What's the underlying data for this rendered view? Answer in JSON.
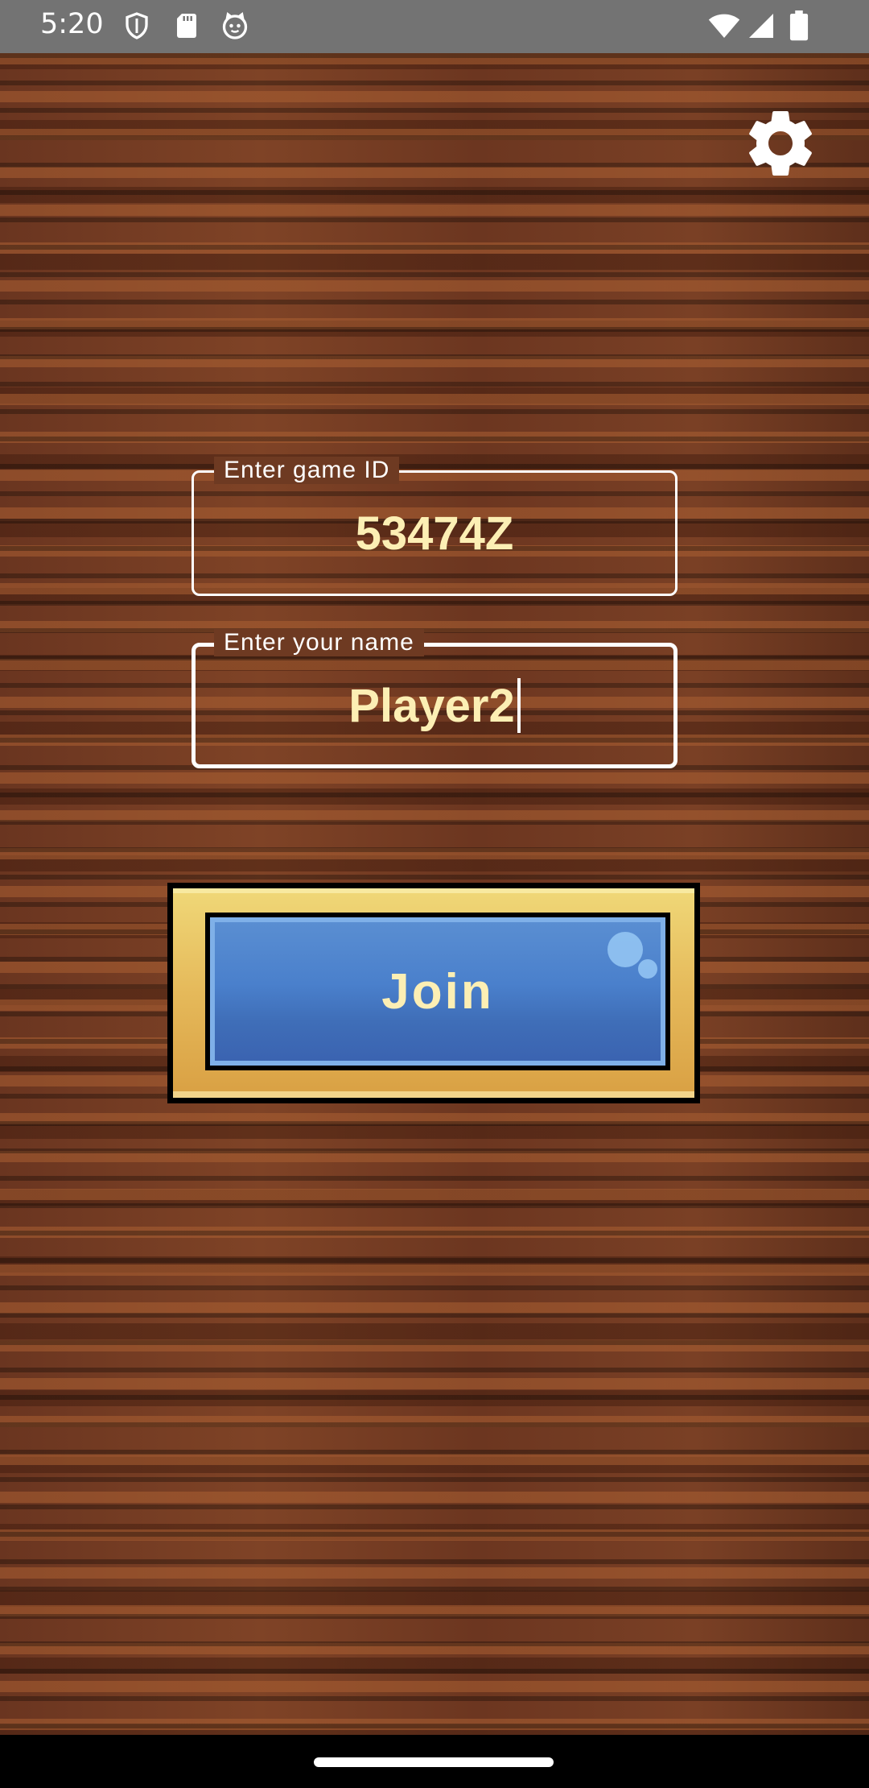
{
  "status_bar": {
    "time": "5:20",
    "left_icons": [
      "shield-icon",
      "sd-card-icon",
      "cat-face-icon"
    ],
    "right_icons": [
      "wifi-icon",
      "signal-icon",
      "battery-icon"
    ]
  },
  "settings": {
    "icon": "gear-icon"
  },
  "game_id_field": {
    "label": "Enter game ID",
    "value": "53474Z"
  },
  "name_field": {
    "label": "Enter your name",
    "value": "Player2",
    "focused": true
  },
  "join_button": {
    "label": "Join"
  },
  "colors": {
    "text_accent": "#fcefb4",
    "button_blue": "#4a80cc",
    "button_frame": "#e5b95a",
    "status_bar": "#737373"
  }
}
